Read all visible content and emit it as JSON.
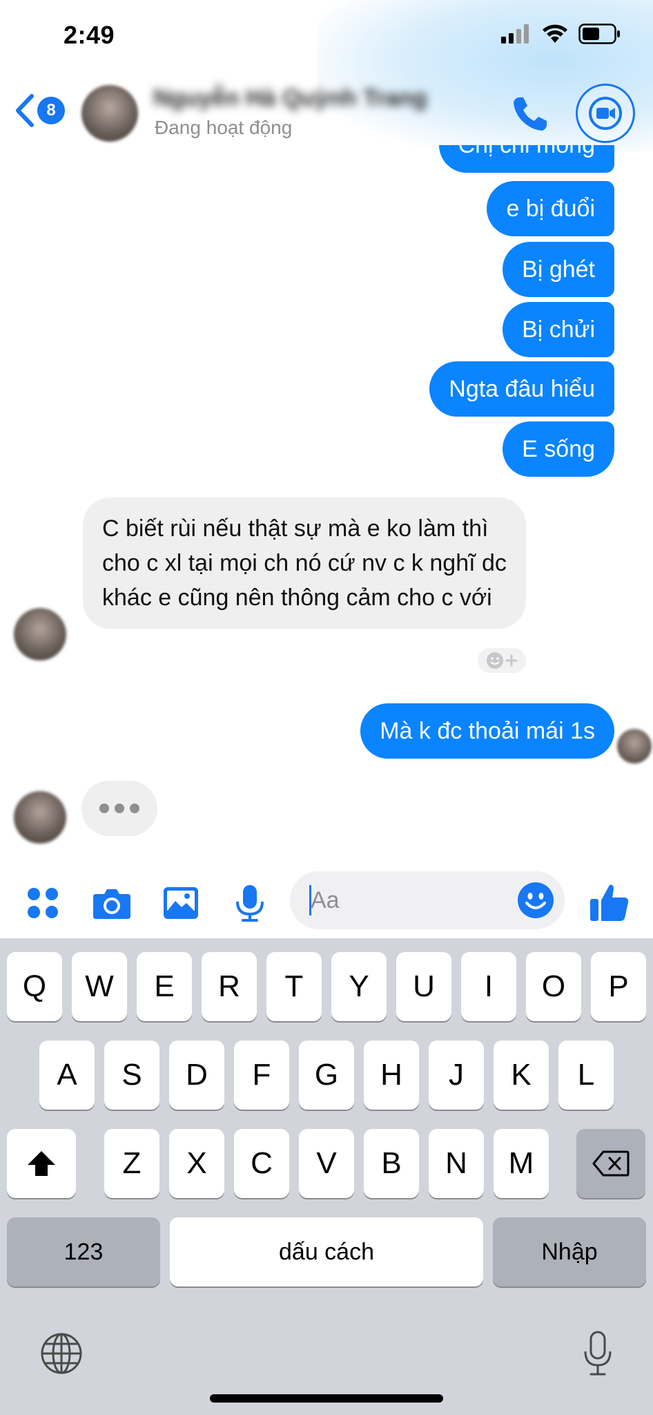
{
  "status_bar": {
    "time": "2:49"
  },
  "header": {
    "back_badge": "8",
    "contact_name": "Nguyễn Hà Quỳnh Trang",
    "contact_status": "Đang hoạt động"
  },
  "messages": {
    "partial_top": "Chị chỉ mong",
    "outgoing": [
      "e bị đuổi",
      "Bị ghét",
      "Bị chửi",
      "Ngta đâu hiểu",
      "E sống"
    ],
    "incoming": "C biết rùi nếu thật sự mà e ko làm thì cho c xl tại mọi ch nó cứ nv c k nghĩ dc khác e cũng nên thông cảm cho c với",
    "last_outgoing": "Mà k đc thoải mái 1s"
  },
  "composer": {
    "placeholder": "Aa"
  },
  "keyboard": {
    "row1": [
      "Q",
      "W",
      "E",
      "R",
      "T",
      "Y",
      "U",
      "I",
      "O",
      "P"
    ],
    "row2": [
      "A",
      "S",
      "D",
      "F",
      "G",
      "H",
      "J",
      "K",
      "L"
    ],
    "row3": [
      "Z",
      "X",
      "C",
      "V",
      "B",
      "N",
      "M"
    ],
    "numbers_key": "123",
    "space_key": "dấu cách",
    "return_key": "Nhập"
  },
  "colors": {
    "accent": "#1877f2",
    "bubble_out": "#0a84ff",
    "bubble_in": "#efeff0",
    "keyboard_bg": "#d1d4da"
  }
}
